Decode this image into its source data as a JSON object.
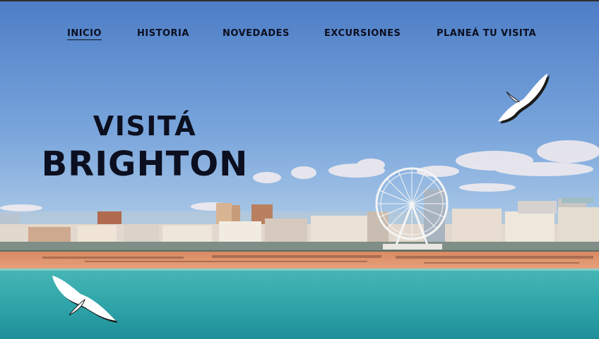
{
  "nav": {
    "items": [
      {
        "label": "INICIO",
        "active": true
      },
      {
        "label": "HISTORIA",
        "active": false
      },
      {
        "label": "NOVEDADES",
        "active": false
      },
      {
        "label": "EXCURSIONES",
        "active": false
      },
      {
        "label": "PLANEÁ TU VISITA",
        "active": false
      }
    ]
  },
  "hero": {
    "line1": "VISITÁ",
    "line2": "BRIGHTON"
  },
  "background": {
    "scene": "brighton-beach-skyline-photo",
    "icons": [
      "seagull-icon",
      "seagull-icon",
      "ferris-wheel-icon"
    ]
  },
  "colors": {
    "text": "#0c0f1f",
    "sky_top": "#4f7fc8",
    "sky_bottom": "#9cc0e6",
    "sand": "#e39468",
    "sea": "#2ba7ab"
  }
}
